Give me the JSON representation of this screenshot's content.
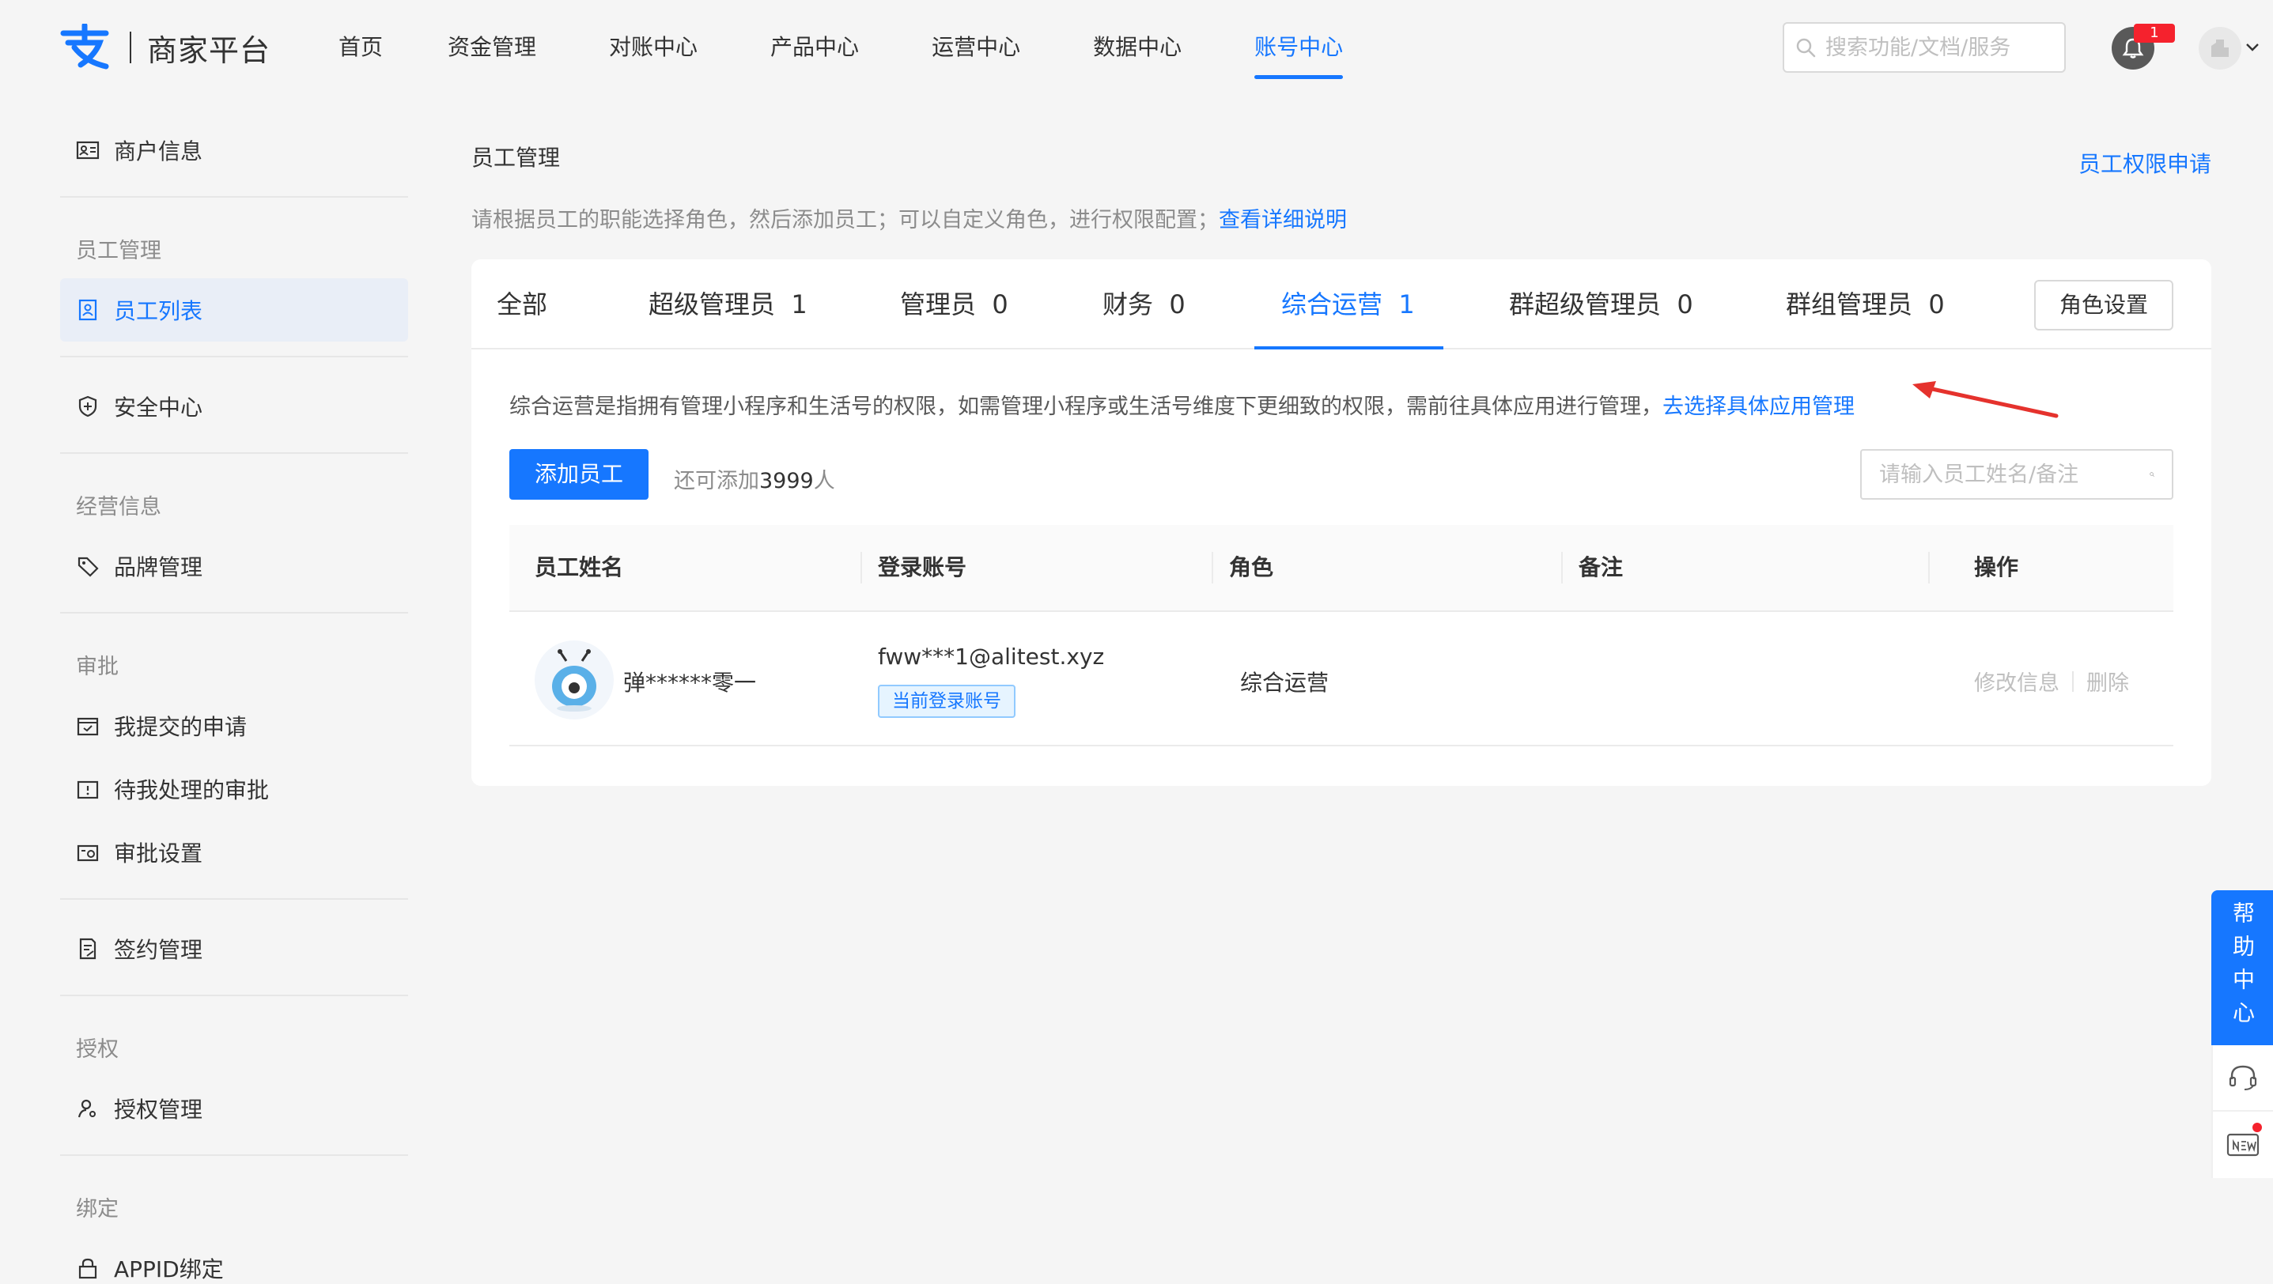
{
  "header": {
    "logo_text": "商家平台",
    "nav": [
      {
        "label": "首页",
        "active": false
      },
      {
        "label": "资金管理",
        "active": false
      },
      {
        "label": "对账中心",
        "active": false
      },
      {
        "label": "产品中心",
        "active": false
      },
      {
        "label": "运营中心",
        "active": false
      },
      {
        "label": "数据中心",
        "active": false
      },
      {
        "label": "账号中心",
        "active": true
      }
    ],
    "search_placeholder": "搜索功能/文档/服务",
    "notification_count": "1"
  },
  "sidebar": {
    "top_item": "商户信息",
    "groups": [
      {
        "title": "员工管理",
        "items": [
          "员工列表"
        ]
      },
      {
        "title": "",
        "items": [
          "安全中心"
        ]
      },
      {
        "title": "经营信息",
        "items": [
          "品牌管理"
        ]
      },
      {
        "title": "审批",
        "items": [
          "我提交的申请",
          "待我处理的审批",
          "审批设置"
        ]
      },
      {
        "title": "",
        "items": [
          "签约管理"
        ]
      },
      {
        "title": "授权",
        "items": [
          "授权管理"
        ]
      },
      {
        "title": "绑定",
        "items": [
          "APPID绑定"
        ]
      }
    ]
  },
  "main": {
    "title": "员工管理",
    "permission_link": "员工权限申请",
    "description": "请根据员工的职能选择角色，然后添加员工；可以自定义角色，进行权限配置；",
    "description_link": "查看详细说明",
    "tabs": [
      {
        "label": "全部",
        "count": ""
      },
      {
        "label": "超级管理员",
        "count": "1"
      },
      {
        "label": "管理员",
        "count": "0"
      },
      {
        "label": "财务",
        "count": "0"
      },
      {
        "label": "综合运营",
        "count": "1",
        "active": true
      },
      {
        "label": "群超级管理员",
        "count": "0"
      },
      {
        "label": "群组管理员",
        "count": "0"
      }
    ],
    "role_settings_button": "角色设置",
    "info_text": "综合运营是指拥有管理小程序和生活号的权限，如需管理小程序或生活号维度下更细致的权限，需前往具体应用进行管理，",
    "info_link": "去选择具体应用管理",
    "add_button": "添加员工",
    "remain_prefix": "还可添加",
    "remain_count": "3999",
    "remain_suffix": "人",
    "employee_search_placeholder": "请输入员工姓名/备注",
    "table": {
      "columns": [
        "员工姓名",
        "登录账号",
        "角色",
        "备注",
        "操作"
      ],
      "rows": [
        {
          "name": "弹******零一",
          "account": "fww***1@alitest.xyz",
          "account_tag": "当前登录账号",
          "role": "综合运营",
          "remark": "",
          "actions": [
            "修改信息",
            "删除"
          ]
        }
      ]
    }
  },
  "float": {
    "help_label": "帮助中心"
  },
  "colors": {
    "primary": "#1677ff",
    "annotation_arrow": "#e5322d"
  }
}
